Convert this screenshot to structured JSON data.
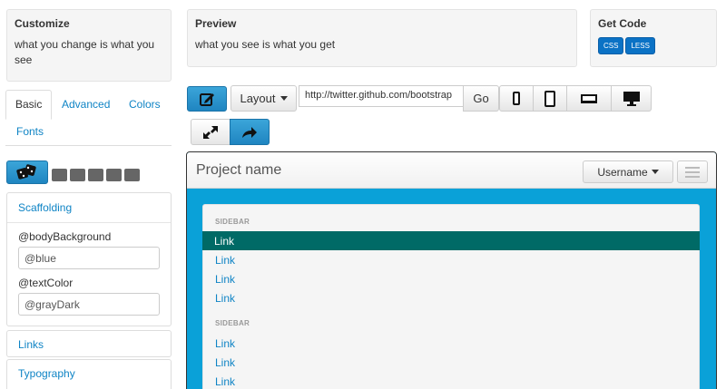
{
  "customize": {
    "title": "Customize",
    "text": "what you change is what you see"
  },
  "preview_info": {
    "title": "Preview",
    "text": "what you see is what you get"
  },
  "get_code": {
    "title": "Get Code",
    "buttons": [
      "CSS",
      "LESS"
    ]
  },
  "tabs": [
    "Basic",
    "Advanced",
    "Colors",
    "Fonts"
  ],
  "scaffolding": {
    "title": "Scaffolding",
    "fields": [
      {
        "label": "@bodyBackground",
        "value": "@blue"
      },
      {
        "label": "@textColor",
        "value": "@grayDark"
      }
    ]
  },
  "panels": [
    "Links",
    "Typography"
  ],
  "toolbar": {
    "layout_label": "Layout",
    "url": "http://twitter.github.com/bootstrap",
    "go_label": "Go",
    "devices": [
      "phone-icon",
      "tablet-icon",
      "laptop-icon",
      "desktop-icon"
    ]
  },
  "preview": {
    "brand": "Project name",
    "user_label": "Username",
    "sections": [
      {
        "header": "SIDEBAR",
        "links": [
          "Link",
          "Link",
          "Link",
          "Link"
        ],
        "active": 0
      },
      {
        "header": "SIDEBAR",
        "links": [
          "Link",
          "Link",
          "Link"
        ],
        "active": -1
      }
    ]
  },
  "colors": {
    "accent": "#1f85c1",
    "active_link": "#006a66",
    "preview_bg": "#0aa1d8",
    "link": "#0f84c5"
  }
}
